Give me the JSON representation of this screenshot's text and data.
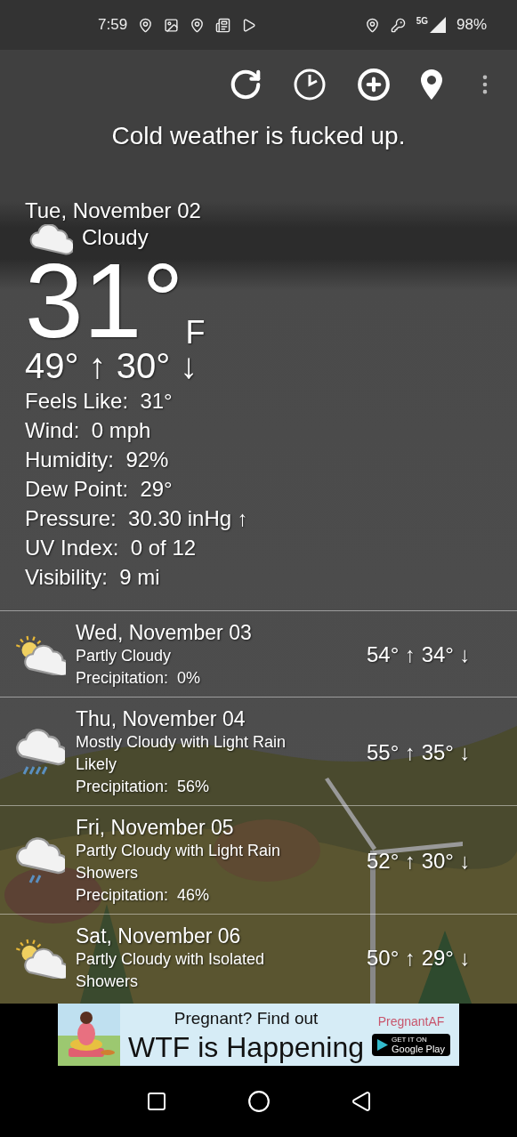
{
  "status_bar": {
    "time": "7:59",
    "network": "5G",
    "battery": "98%"
  },
  "title": "Cold weather is fucked up.",
  "current": {
    "date": "Tue, November 02",
    "condition": "Cloudy",
    "kind": "cloudy",
    "temperature": "31°",
    "unit": "F",
    "hi_lo": "49° ↑ 30° ↓",
    "details": [
      {
        "label": "Feels Like:",
        "value": "31°"
      },
      {
        "label": "Wind:",
        "value": "0 mph"
      },
      {
        "label": "Humidity:",
        "value": "92%"
      },
      {
        "label": "Dew Point:",
        "value": "29°"
      },
      {
        "label": "Pressure:",
        "value": "30.30 inHg ↑"
      },
      {
        "label": "UV Index:",
        "value": "0 of 12"
      },
      {
        "label": "Visibility:",
        "value": "9 mi"
      }
    ]
  },
  "forecast": [
    {
      "date": "Wed, November 03",
      "condition": "Partly Cloudy",
      "precipitation_label": "Precipitation:",
      "precipitation": "0%",
      "hi_lo": "54° ↑ 34° ↓",
      "kind": "partly_cloudy"
    },
    {
      "date": "Thu, November 04",
      "condition": "Mostly Cloudy with Light Rain Likely",
      "precipitation_label": "Precipitation:",
      "precipitation": "56%",
      "hi_lo": "55° ↑ 35° ↓",
      "kind": "rain"
    },
    {
      "date": "Fri, November 05",
      "condition": "Partly Cloudy with Light Rain Showers",
      "precipitation_label": "Precipitation:",
      "precipitation": "46%",
      "hi_lo": "52° ↑ 30° ↓",
      "kind": "light_rain"
    },
    {
      "date": "Sat, November 06",
      "condition": "Partly Cloudy with Isolated Showers",
      "hi_lo": "50° ↑ 29° ↓",
      "kind": "partly_cloudy"
    }
  ],
  "ad": {
    "headline": "Pregnant? Find out",
    "tagline": "WTF is Happening",
    "brand": "PregnantAF",
    "badge_small": "GET IT ON",
    "badge_large": "Google Play"
  }
}
